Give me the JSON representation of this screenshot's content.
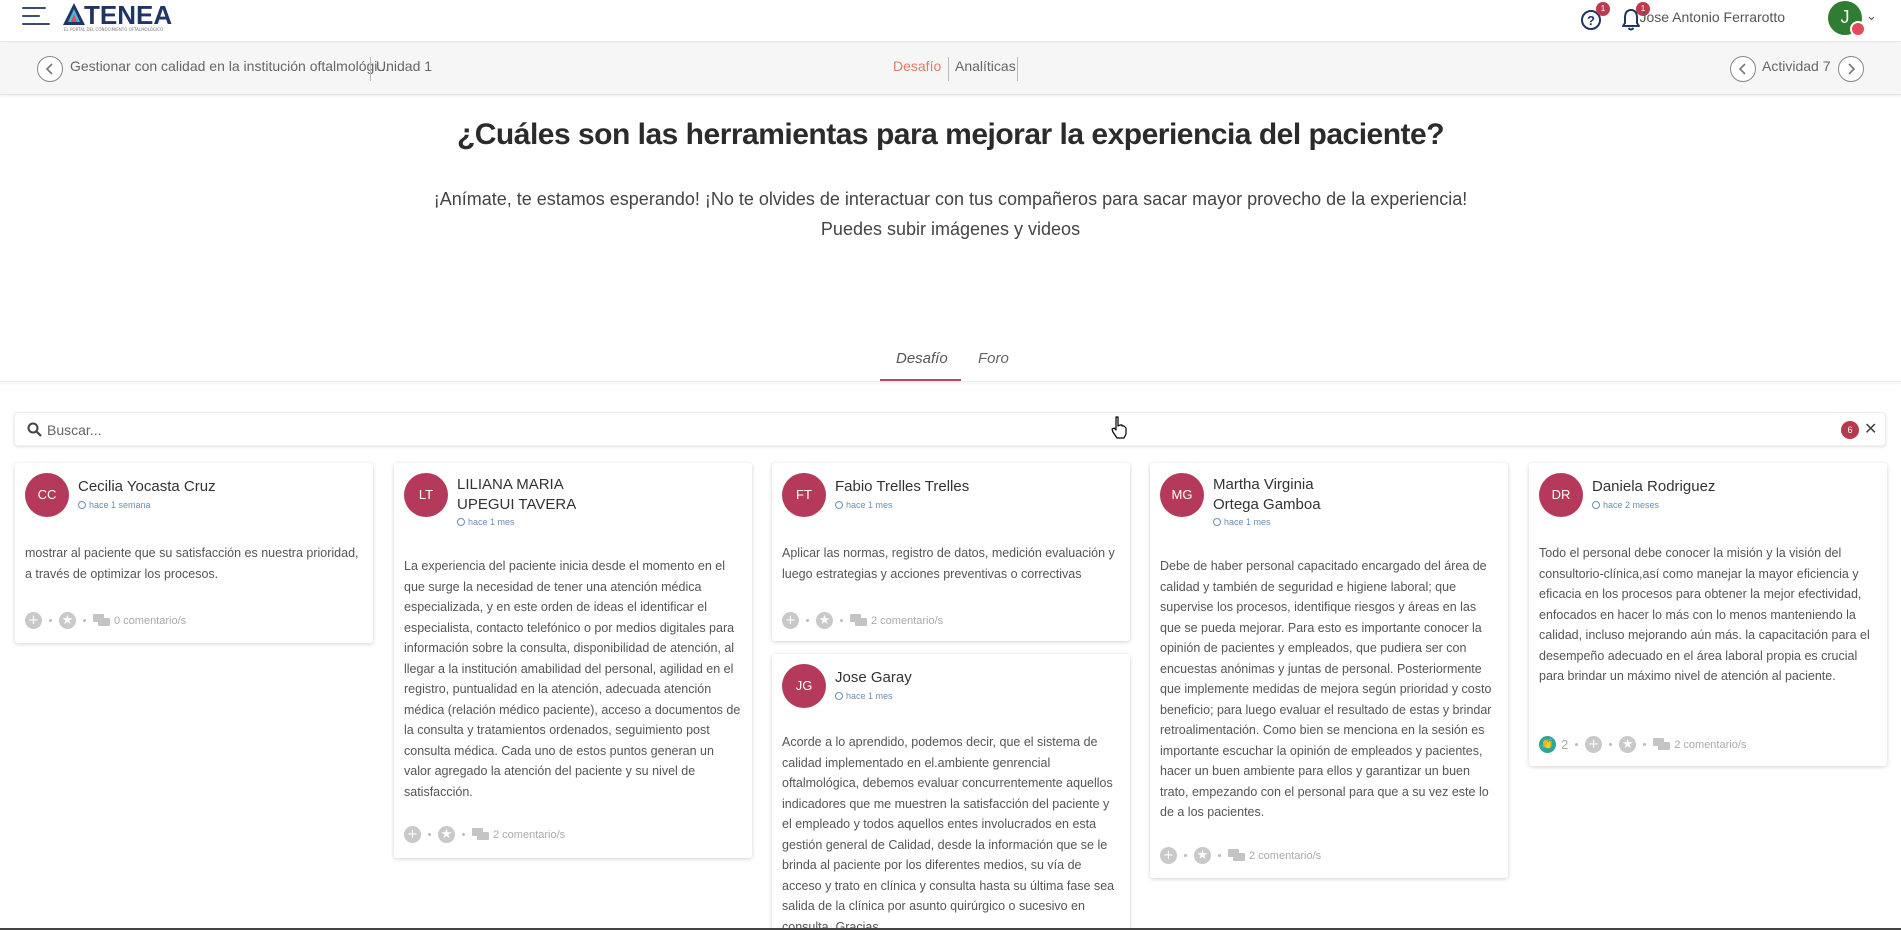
{
  "header": {
    "logo_text": "TENEA",
    "logo_tagline": "EL PORTAL DEL CONOCIMIENTO OFTALMOLÓGICO",
    "help_badge": "1",
    "notif_badge": "1",
    "user_name": "Jose Antonio Ferrarotto",
    "user_initial": "J"
  },
  "breadcrumb": {
    "course": "Gestionar con calidad en la institución oftalmológi...",
    "unit": "Unidad 1",
    "tab_desafio": "Desafío",
    "tab_analiticas": "Analíticas",
    "activity": "Actividad 7"
  },
  "page": {
    "title": "¿Cuáles son las herramientas para mejorar la experiencia del paciente?",
    "subtitle_line1": "¡Anímate, te estamos esperando! ¡No te olvides de interactuar con tus compañeros para sacar mayor provecho de la experiencia!",
    "subtitle_line2": "Puedes subir imágenes y videos"
  },
  "tabs": {
    "desafio": "Desafío",
    "foro": "Foro"
  },
  "search": {
    "placeholder": "Buscar...",
    "count": "6"
  },
  "posts": [
    {
      "initials": "CC",
      "name": "Cecilia Yocasta Cruz",
      "time": "hace 1 semana",
      "body": "mostrar al paciente que su satisfacción es nuestra prioridad, a través de optimizar los procesos.",
      "comments": "0 comentario/s"
    },
    {
      "initials": "LT",
      "name": "LILIANA MARIA UPEGUI TAVERA",
      "time": "hace 1 mes",
      "body": "La experiencia del paciente inicia desde el momento en el que surge la necesidad de tener una atención médica especializada, y en este orden de ideas el identificar el especialista, contacto telefónico o por medios digitales para información sobre la consulta, disponibilidad de atención, al llegar a la institución amabilidad del personal, agilidad en el registro, puntualidad en la atención, adecuada atención médica (relación médico paciente), acceso a documentos de la consulta y tratamientos ordenados, seguimiento post consulta médica. Cada uno de estos puntos generan un valor agregado la atención del paciente y su nivel de satisfacción.",
      "comments": "2 comentario/s"
    },
    {
      "initials": "FT",
      "name": "Fabio Trelles Trelles",
      "time": "hace 1 mes",
      "body": "Aplicar las normas, registro de datos, medición evaluación y luego estrategias y acciones preventivas o correctivas",
      "comments": "2 comentario/s"
    },
    {
      "initials": "JG",
      "name": "Jose Garay",
      "time": "hace 1 mes",
      "body": "Acorde a lo aprendido, podemos decir, que el sistema de calidad implementado en el.ambiente genrencial oftalmológica, debemos evaluar concurrentemente aquellos indicadores que me muestren la satisfacción del paciente y el empleado y todos aquellos entes involucrados en esta gestión general de Calidad, desde la información que se le brinda al paciente por los diferentes medios, su vía de acceso y trato en clínica y consulta hasta su última fase sea salida de la clínica por asunto quirúrgico o sucesivo en consulta. Gracias"
    },
    {
      "initials": "MG",
      "name": "Martha Virginia Ortega Gamboa",
      "time": "hace 1 mes",
      "body": "Debe de haber personal capacitado encargado del área de calidad y también de seguridad e higiene laboral; que supervise los procesos, identifique riesgos y áreas en las que se pueda mejorar. Para esto es importante conocer la opinión de pacientes y empleados, que pudiera ser con encuestas anónimas y juntas de personal. Posteriormente que implemente medidas de mejora según prioridad y costo beneficio; para luego evaluar el resultado de estas y brindar retroalimentación. Como bien se menciona en la sesión es importante escuchar la opinión de empleados y pacientes, hacer un buen ambiente para ellos y garantizar un buen trato, empezando con el personal para que a su vez este lo de a los pacientes.",
      "comments": "2 comentario/s"
    },
    {
      "initials": "DR",
      "name": "Daniela Rodriguez",
      "time": "hace 2 meses",
      "body": "Todo el personal debe conocer la misión y la visión del consultorio-clínica,así como manejar la mayor eficiencia y eficacia en los procesos para obtener la mejor efectividad, enfocados en hacer lo más con lo menos manteniendo la calidad, incluso mejorando aún más. la capacitación para el desempeño adecuado en el área laboral propia es crucial para brindar un máximo nivel de atención al paciente.",
      "reactions": "2",
      "comments": "2 comentario/s"
    }
  ],
  "colors": {
    "brand_navy": "#1f3566",
    "accent_red": "#c0465a",
    "avatar_bg": "#b5395a",
    "time_blue": "#6a8fb3"
  }
}
